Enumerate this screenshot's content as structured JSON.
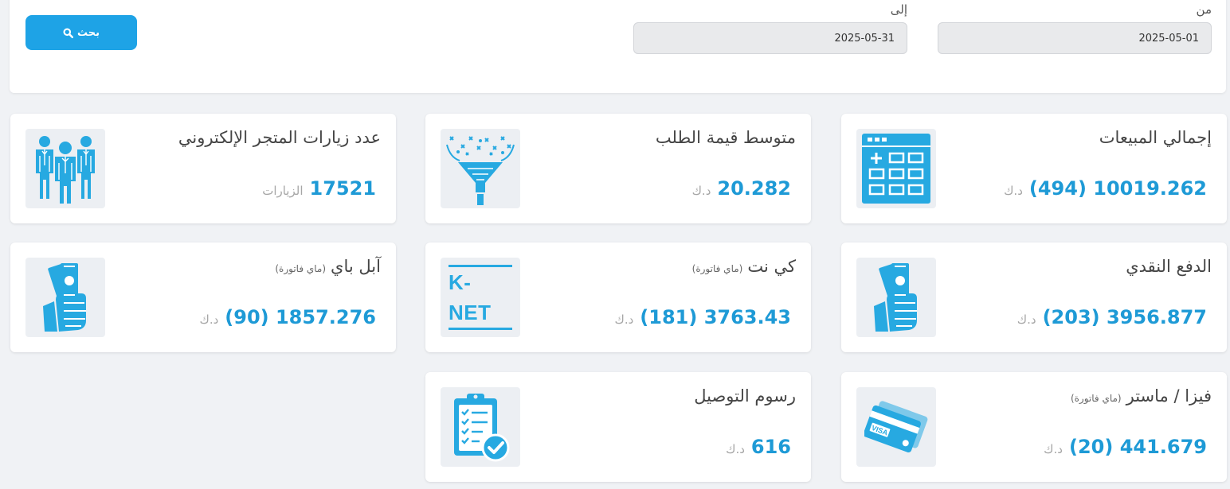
{
  "filter": {
    "from_label": "من",
    "to_label": "إلى",
    "from_value": "2025-05-01",
    "to_value": "2025-05-31",
    "search_label": "بحث",
    "search_icon": "magnifier-icon"
  },
  "colors": {
    "accent": "#1ea3e6",
    "value_text": "#1e9ad6",
    "icon": "#27a9e1",
    "page_bg": "#f0f2f5"
  },
  "cards": {
    "total_sales": {
      "title": "إجمالي المبيعات",
      "value": "10019.262 (494)",
      "unit": "د.ك",
      "icon": "calculator-icon"
    },
    "avg_order": {
      "title": "متوسط قيمة الطلب",
      "value": "20.282",
      "unit": "د.ك",
      "icon": "funnel-icon"
    },
    "visits": {
      "title": "عدد زيارات المتجر الإلكتروني",
      "value": "17521",
      "unit": "الزيارات",
      "icon": "people-icon"
    },
    "cash": {
      "title": "الدفع النقدي",
      "value": "3956.877 (203)",
      "unit": "د.ك",
      "icon": "cash-hand-icon"
    },
    "knet": {
      "title": "كي نت",
      "sub": "(ماي فاتورة)",
      "value": "3763.43 (181)",
      "unit": "د.ك",
      "icon": "knet-logo-icon",
      "logo_text": "K-NET"
    },
    "applepay": {
      "title": "آبل باي",
      "sub": "(ماي فاتورة)",
      "value": "1857.276 (90)",
      "unit": "د.ك",
      "icon": "cash-hand-icon"
    },
    "visa": {
      "title": "فيزا / ماستر",
      "sub": "(ماي فاتورة)",
      "value": "441.679 (20)",
      "unit": "د.ك",
      "icon": "credit-card-icon",
      "card_text": "VISA"
    },
    "delivery": {
      "title": "رسوم التوصيل",
      "value": "616",
      "unit": "د.ك",
      "icon": "checklist-icon"
    }
  }
}
